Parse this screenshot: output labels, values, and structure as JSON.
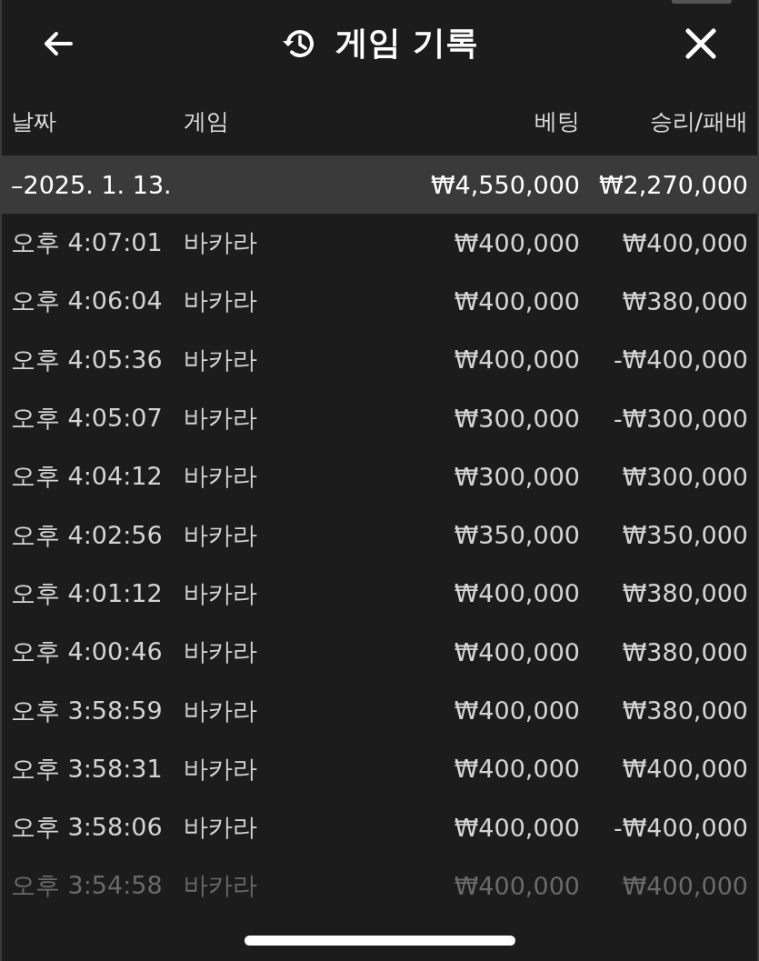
{
  "header": {
    "title": "게임 기록"
  },
  "table": {
    "columns": [
      "날짜",
      "게임",
      "베팅",
      "승리/패배"
    ],
    "group": {
      "toggle": "–",
      "date": "2025. 1. 13.",
      "bet": "₩4,550,000",
      "result": "₩2,270,000"
    },
    "rows": [
      {
        "time": "오후 4:07:01",
        "game": "바카라",
        "bet": "₩400,000",
        "result": "₩400,000",
        "faded": false
      },
      {
        "time": "오후 4:06:04",
        "game": "바카라",
        "bet": "₩400,000",
        "result": "₩380,000",
        "faded": false
      },
      {
        "time": "오후 4:05:36",
        "game": "바카라",
        "bet": "₩400,000",
        "result": "-₩400,000",
        "faded": false
      },
      {
        "time": "오후 4:05:07",
        "game": "바카라",
        "bet": "₩300,000",
        "result": "-₩300,000",
        "faded": false
      },
      {
        "time": "오후 4:04:12",
        "game": "바카라",
        "bet": "₩300,000",
        "result": "₩300,000",
        "faded": false
      },
      {
        "time": "오후 4:02:56",
        "game": "바카라",
        "bet": "₩350,000",
        "result": "₩350,000",
        "faded": false
      },
      {
        "time": "오후 4:01:12",
        "game": "바카라",
        "bet": "₩400,000",
        "result": "₩380,000",
        "faded": false
      },
      {
        "time": "오후 4:00:46",
        "game": "바카라",
        "bet": "₩400,000",
        "result": "₩380,000",
        "faded": false
      },
      {
        "time": "오후 3:58:59",
        "game": "바카라",
        "bet": "₩400,000",
        "result": "₩380,000",
        "faded": false
      },
      {
        "time": "오후 3:58:31",
        "game": "바카라",
        "bet": "₩400,000",
        "result": "₩400,000",
        "faded": false
      },
      {
        "time": "오후 3:58:06",
        "game": "바카라",
        "bet": "₩400,000",
        "result": "-₩400,000",
        "faded": false
      },
      {
        "time": "오후 3:54:58",
        "game": "바카라",
        "bet": "₩400,000",
        "result": "₩400,000",
        "faded": true
      }
    ]
  }
}
